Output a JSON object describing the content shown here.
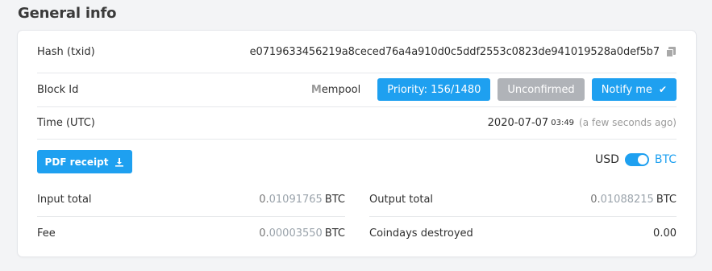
{
  "section": {
    "title": "General info"
  },
  "hash": {
    "label": "Hash (txid)",
    "value": "e0719633456219a8ceced76a4a910d0c5ddf2553c0823de941019528a0def5b7"
  },
  "block": {
    "label": "Block Id",
    "mempool_initial": "M",
    "mempool_rest": "empool",
    "priority_label": "Priority: 156/1480",
    "status_label": "Unconfirmed",
    "notify_label": "Notify me",
    "notify_check": "✔"
  },
  "time": {
    "label": "Time (UTC)",
    "date": "2020-07-07",
    "hm": "03:49",
    "relative": "(a few seconds ago)"
  },
  "receipt": {
    "label": "PDF receipt"
  },
  "currency": {
    "left": "USD",
    "right": "BTC",
    "selected": "BTC"
  },
  "amounts": {
    "input_total": {
      "label": "Input total",
      "int": "0.",
      "dec": "01091765",
      "unit": "BTC"
    },
    "output_total": {
      "label": "Output total",
      "int": "0.",
      "dec": "01088215",
      "unit": "BTC"
    },
    "fee": {
      "label": "Fee",
      "int": "0.",
      "dec": "00003550",
      "unit": "BTC"
    },
    "coindays": {
      "label": "Coindays destroyed",
      "value": "0.00"
    }
  },
  "colors": {
    "accent": "#1ea0f0",
    "muted_button": "#b0b3b8",
    "background": "#f3f4f6"
  }
}
